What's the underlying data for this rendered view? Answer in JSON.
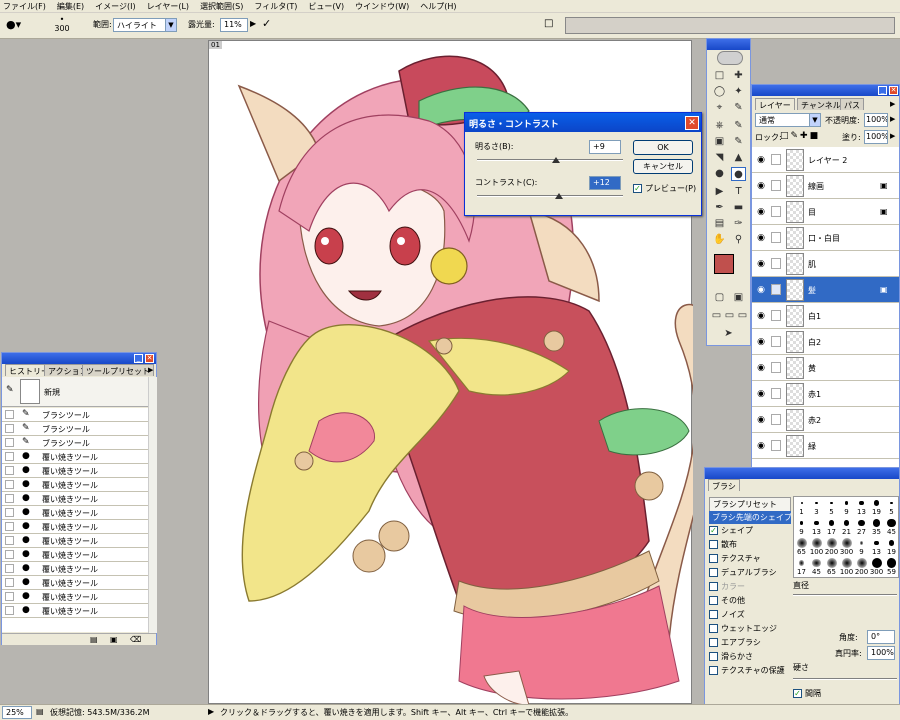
{
  "menu": [
    "ファイル(F)",
    "編集(E)",
    "イメージ(I)",
    "レイヤー(L)",
    "選択範囲(S)",
    "フィルタ(T)",
    "ビュー(V)",
    "ウインドウ(W)",
    "ヘルプ(H)"
  ],
  "options": {
    "brush_size": "300",
    "range_label": "範囲:",
    "range_value": "ハイライト",
    "exposure_label": "露光量:",
    "exposure_value": "11%"
  },
  "doc": {
    "tab_label": "01"
  },
  "brightness_dialog": {
    "title": "明るさ・コントラスト",
    "brightness_label": "明るさ(B):",
    "brightness_value": "+9",
    "contrast_label": "コントラスト(C):",
    "contrast_value": "+12",
    "ok": "OK",
    "cancel": "キャンセル",
    "preview": "プレビュー(P)",
    "brightness_level": 0.54,
    "contrast_level": 0.56
  },
  "history": {
    "tabs": [
      "ヒストリー",
      "アクション",
      "ツールプリセット"
    ],
    "snapshot": "新規",
    "items": [
      "ブラシツール",
      "ブラシツール",
      "ブラシツール",
      "覆い焼きツール",
      "覆い焼きツール",
      "覆い焼きツール",
      "覆い焼きツール",
      "覆い焼きツール",
      "覆い焼きツール",
      "覆い焼きツール",
      "覆い焼きツール",
      "覆い焼きツール",
      "覆い焼きツール",
      "覆い焼きツール",
      "覆い焼きツール"
    ]
  },
  "layers": {
    "tabs": [
      "レイヤー",
      "チャンネル",
      "パス"
    ],
    "blend": "通常",
    "opacity_label": "不透明度:",
    "opacity": "100%",
    "lock_label": "ロック:",
    "fill_label": "塗り:",
    "fill": "100%",
    "items": [
      "レイヤー 2",
      "線画",
      "目",
      "口・白目",
      "肌",
      "髪",
      "白1",
      "白2",
      "黄",
      "赤1",
      "赤2",
      "緑"
    ],
    "selected_index": 5
  },
  "brush": {
    "tab": "ブラシ",
    "presets_label": "ブラシプリセット",
    "tip_shape": "ブラシ先端のシェイプ",
    "options": [
      "シェイプ",
      "散布",
      "テクスチャ",
      "デュアルブラシ",
      "カラー",
      "その他",
      "ノイズ",
      "ウェットエッジ",
      "エアブラシ",
      "滑らかさ",
      "テクスチャの保護"
    ],
    "checked": [
      true,
      false,
      false,
      false,
      false,
      false,
      false,
      false,
      false,
      false,
      false
    ],
    "sizes": [
      "1",
      "3",
      "5",
      "9",
      "13",
      "19",
      "5",
      "9",
      "13",
      "17",
      "21",
      "27",
      "35",
      "45",
      "65",
      "100",
      "200",
      "300",
      "9",
      "13",
      "19",
      "17",
      "45",
      "65",
      "100",
      "200",
      "300",
      "59"
    ],
    "diameter_label": "直径",
    "angle_label": "角度:",
    "angle": "0°",
    "roundness_label": "真円率:",
    "roundness": "100%",
    "hardness_label": "硬さ",
    "spacing_label": "間隔"
  },
  "status": {
    "zoom": "25%",
    "doc_label": "仮想記憶: 543.5M/336.2M",
    "hint": "クリック＆ドラッグすると、覆い焼きを適用します。Shift キー、Alt キー、Ctrl キーで機能拡張。"
  },
  "colors": {
    "foreground": "#c0504d",
    "background": "#f0e070"
  }
}
